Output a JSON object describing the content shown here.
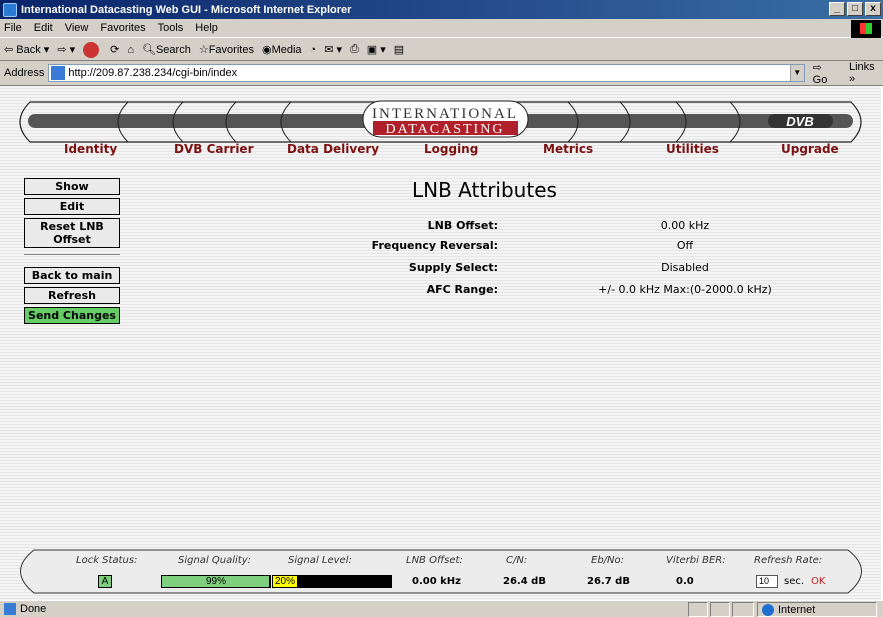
{
  "window": {
    "title": "International Datacasting Web GUI - Microsoft Internet Explorer",
    "buttons": [
      "_",
      "□",
      "x"
    ]
  },
  "menu": [
    "File",
    "Edit",
    "View",
    "Favorites",
    "Tools",
    "Help"
  ],
  "toolbar": {
    "back": "Back",
    "search": "Search",
    "favorites": "Favorites",
    "media": "Media"
  },
  "address": {
    "label": "Address",
    "url": "http://209.87.238.234/cgi-bin/index",
    "go": "Go",
    "links": "Links »"
  },
  "banner": {
    "brand_top": "INTERNATIONAL",
    "brand_bottom": "DATACASTING",
    "logo": "DVB"
  },
  "nav": [
    "Identity",
    "DVB Carrier",
    "Data Delivery",
    "Logging",
    "Metrics",
    "Utilities",
    "Upgrade"
  ],
  "sidebar": {
    "show": "Show",
    "edit": "Edit",
    "reset": "Reset LNB Offset",
    "back": "Back to main",
    "refresh": "Refresh",
    "send": "Send Changes"
  },
  "page": {
    "title": "LNB Attributes",
    "attributes": [
      {
        "label": "LNB Offset:",
        "value": "0.00 kHz"
      },
      {
        "label": "Frequency Reversal:",
        "value": "Off"
      },
      {
        "label": "Supply Select:",
        "value": "Disabled"
      },
      {
        "label": "AFC Range:",
        "value": "+/- 0.0 kHz Max:(0-2000.0 kHz)"
      }
    ]
  },
  "status": {
    "lock_label": "Lock Status:",
    "lock_value": "A",
    "quality_label": "Signal Quality:",
    "quality_value": "99%",
    "quality_fraction": 0.99,
    "level_label": "Signal Level:",
    "level_value": "20%",
    "level_fraction": 0.2,
    "lnb_label": "LNB Offset:",
    "lnb_value": "0.00 kHz",
    "cn_label": "C/N:",
    "cn_value": "26.4 dB",
    "ebno_label": "Eb/No:",
    "ebno_value": "26.7 dB",
    "ber_label": "Viterbi BER:",
    "ber_value": "0.0",
    "refresh_label": "Refresh Rate:",
    "refresh_value": "10",
    "refresh_unit": "sec.",
    "ok": "OK"
  },
  "statusbar": {
    "done": "Done",
    "zone": "Internet"
  },
  "colors": {
    "nav_text": "#7a1010",
    "send_button": "#66cc66",
    "quality_fill": "#7ed07e",
    "level_fill": "#ffff00",
    "brand_red": "#b0202a"
  }
}
